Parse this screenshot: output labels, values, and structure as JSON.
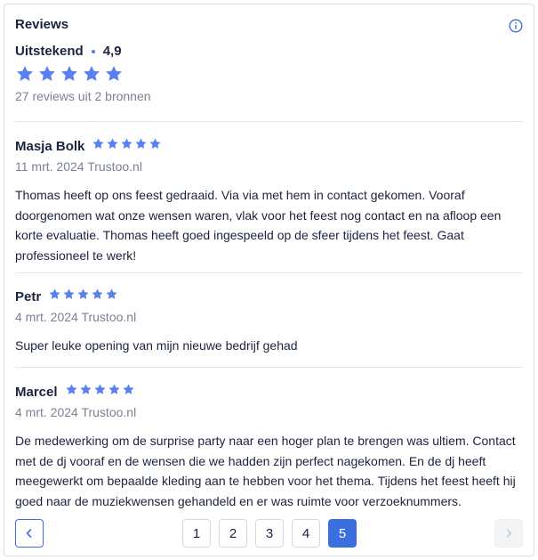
{
  "header": {
    "title": "Reviews",
    "info_icon": "info-icon"
  },
  "summary": {
    "label": "Uitstekend",
    "score": "4,9",
    "stars": 5,
    "count_text": "27 reviews uit 2 bronnen"
  },
  "colors": {
    "star": "#5a7ff0",
    "accent": "#3b6fe0"
  },
  "reviews": [
    {
      "name": "Masja Bolk",
      "stars": 5,
      "meta": "11 mrt. 2024 Trustoo.nl",
      "text": "Thomas heeft op ons feest gedraaid. Via via met hem in contact gekomen. Vooraf doorgenomen wat onze wensen waren, vlak voor het feest nog contact en na afloop een korte evaluatie. Thomas heeft goed ingespeeld op de sfeer tijdens het feest. Gaat professioneel te werk!"
    },
    {
      "name": "Petr",
      "stars": 5,
      "meta": "4 mrt. 2024 Trustoo.nl",
      "text": "Super leuke opening van mijn nieuwe bedrijf gehad"
    },
    {
      "name": "Marcel",
      "stars": 5,
      "meta": "4 mrt. 2024 Trustoo.nl",
      "text": "De medewerking om de surprise party naar een hoger plan te brengen was ultiem. Contact met de dj vooraf en de wensen die we hadden zijn perfect nagekomen. En de dj heeft meegewerkt om bepaalde kleding aan te hebben voor het thema. Tijdens het feest heeft hij goed naar de muziekwensen gehandeld en er was ruimte voor verzoeknummers."
    }
  ],
  "pagination": {
    "prev_icon": "chevron-left-icon",
    "next_icon": "chevron-right-icon",
    "pages": [
      "1",
      "2",
      "3",
      "4",
      "5"
    ],
    "active_page": "5"
  }
}
